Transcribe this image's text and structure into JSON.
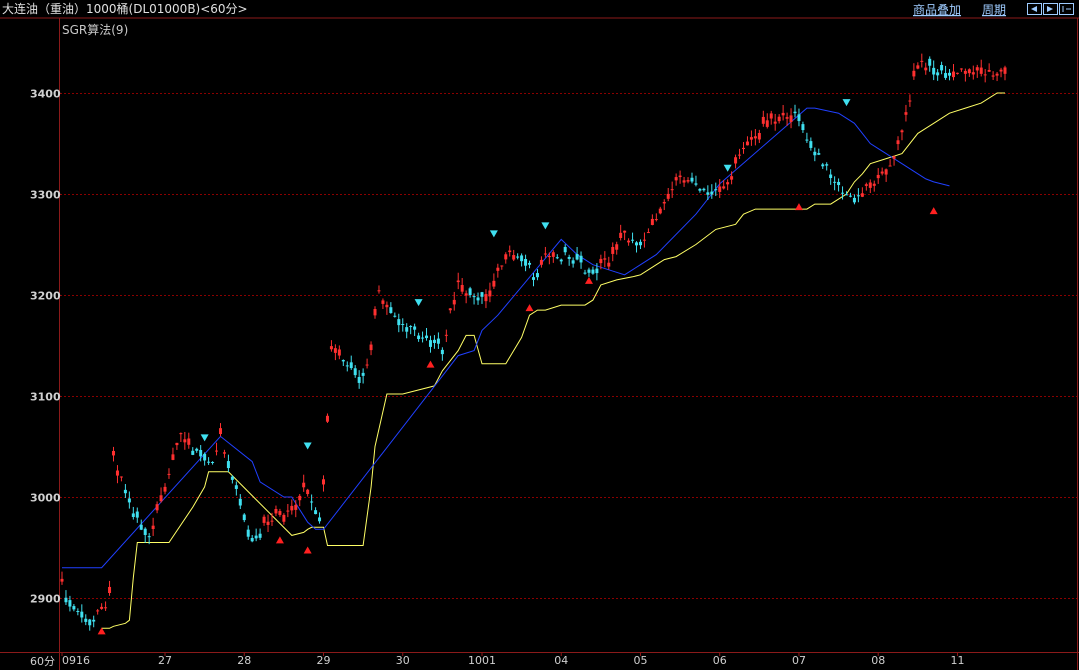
{
  "header": {
    "title": "大连油（重油）1000桶(DL01000B)<60分>",
    "overlay_label": "商品叠加",
    "period_label": "周期"
  },
  "indicator_label": "SGR算法(9)",
  "period_unit": "60分",
  "colors": {
    "background": "#000000",
    "frame": "#8b1a1a",
    "up_candle": "#ff3030",
    "down_candle": "#40e0f0",
    "support_line": "#ffff66",
    "resistance_line": "#2040ff",
    "buy_marker": "#ff2020",
    "sell_marker": "#40e0f0",
    "grid": "#8b0000"
  },
  "icons": [
    "nav-left-icon",
    "nav-right-icon",
    "nav-expand-icon"
  ],
  "chart_data": {
    "type": "candlestick",
    "ylim": [
      2865,
      3450
    ],
    "yticks": [
      2900,
      3000,
      3100,
      3200,
      3300,
      3400
    ],
    "grid": true,
    "x_labels": [
      "0916",
      "27",
      "28",
      "29",
      "30",
      "1001",
      "04",
      "05",
      "06",
      "07",
      "08",
      "11"
    ],
    "x_label_bar_index": [
      0,
      26,
      46,
      66,
      86,
      106,
      126,
      146,
      166,
      186,
      206,
      226
    ],
    "series": [
      {
        "name": "price",
        "anchors_bar_index": [
          0,
          3,
          8,
          10,
          12,
          13,
          18,
          22,
          26,
          30,
          34,
          38,
          40,
          44,
          48,
          52,
          56,
          58,
          62,
          65,
          66,
          68,
          70,
          72,
          76,
          78,
          80,
          84,
          88,
          90,
          94,
          96,
          98,
          100,
          102,
          104,
          108,
          112,
          116,
          120,
          122,
          124,
          126,
          128,
          130,
          134,
          138,
          142,
          146,
          150,
          154,
          156,
          160,
          164,
          168,
          170,
          174,
          178,
          180,
          184,
          186,
          190,
          194,
          198,
          200,
          202,
          204,
          208,
          212,
          214,
          216,
          220,
          222,
          224,
          226,
          228,
          232,
          236,
          238
        ],
        "anchors_close": [
          2912,
          2890,
          2878,
          2888,
          2900,
          3038,
          2982,
          2962,
          3015,
          3060,
          3045,
          3032,
          3058,
          3005,
          2960,
          2975,
          2985,
          2990,
          3012,
          2975,
          3015,
          3148,
          3140,
          3135,
          3118,
          3150,
          3205,
          3180,
          3165,
          3160,
          3150,
          3145,
          3185,
          3210,
          3205,
          3195,
          3200,
          3245,
          3235,
          3215,
          3245,
          3240,
          3238,
          3238,
          3232,
          3222,
          3235,
          3260,
          3245,
          3280,
          3300,
          3318,
          3310,
          3300,
          3310,
          3328,
          3355,
          3368,
          3372,
          3382,
          3370,
          3345,
          3318,
          3300,
          3295,
          3302,
          3310,
          3320,
          3360,
          3395,
          3428,
          3425,
          3420,
          3420,
          3420,
          3420,
          3420,
          3420,
          3420
        ]
      },
      {
        "name": "support",
        "x": [
          10,
          12,
          13,
          16,
          17,
          18,
          19,
          27,
          33,
          36,
          37,
          42,
          58,
          61,
          62,
          63,
          66,
          67,
          72,
          76,
          78,
          79,
          82,
          84,
          86,
          94,
          96,
          100,
          102,
          104,
          106,
          112,
          116,
          118,
          120,
          122,
          126,
          132,
          134,
          136,
          140,
          144,
          146,
          150,
          152,
          155,
          160,
          165,
          170,
          172,
          175,
          180,
          184,
          188,
          190,
          194,
          198,
          200,
          202,
          204,
          212,
          216,
          220,
          224,
          228,
          232,
          236,
          238
        ],
        "values": [
          2870,
          2870,
          2872,
          2875,
          2878,
          2920,
          2955,
          2955,
          2990,
          3010,
          3025,
          3025,
          2962,
          2965,
          2968,
          2970,
          2970,
          2952,
          2952,
          2952,
          3010,
          3050,
          3102,
          3102,
          3102,
          3110,
          3125,
          3145,
          3160,
          3160,
          3132,
          3132,
          3158,
          3180,
          3185,
          3185,
          3190,
          3190,
          3195,
          3210,
          3215,
          3218,
          3220,
          3230,
          3235,
          3238,
          3250,
          3265,
          3270,
          3280,
          3285,
          3285,
          3285,
          3285,
          3290,
          3290,
          3300,
          3312,
          3320,
          3330,
          3340,
          3360,
          3370,
          3380,
          3385,
          3390,
          3400,
          3400
        ]
      },
      {
        "name": "resistance",
        "x": [
          0,
          8,
          10,
          40,
          48,
          50,
          56,
          58,
          62,
          64,
          66,
          100,
          104,
          106,
          110,
          126,
          130,
          134,
          138,
          142,
          146,
          150,
          160,
          164,
          166,
          188,
          190,
          196,
          200,
          202,
          204,
          206,
          208,
          212,
          216,
          218,
          220,
          222,
          224
        ],
        "values": [
          2930,
          2930,
          2930,
          3060,
          3035,
          3015,
          3000,
          3000,
          2975,
          2968,
          2968,
          3140,
          3145,
          3165,
          3180,
          3255,
          3240,
          3230,
          3225,
          3220,
          3230,
          3240,
          3280,
          3300,
          3310,
          3385,
          3385,
          3380,
          3370,
          3360,
          3350,
          3345,
          3340,
          3330,
          3320,
          3315,
          3312,
          3310,
          3308
        ]
      },
      {
        "name": "buy_signals",
        "bar_index": [
          10,
          55,
          62,
          93,
          118,
          133,
          186,
          220
        ],
        "values": [
          2868,
          2958,
          2948,
          3132,
          3188,
          3215,
          3288,
          3284
        ]
      },
      {
        "name": "sell_signals",
        "bar_index": [
          36,
          62,
          90,
          109,
          122,
          168,
          198
        ],
        "values": [
          3058,
          3050,
          3192,
          3260,
          3268,
          3325,
          3390
        ]
      }
    ]
  }
}
